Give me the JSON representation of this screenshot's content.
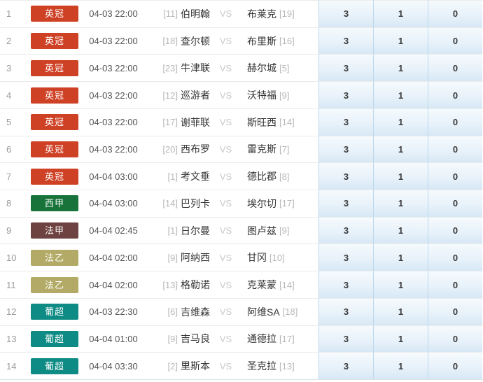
{
  "league_colors": {
    "英冠": "#ce4125",
    "西甲": "#177339",
    "法甲": "#6e4240",
    "法乙": "#b2aa66",
    "葡超": "#0e8b84"
  },
  "odds_colors": {
    "cell_bg_top": "#f5fafd",
    "cell_bg_bottom": "#d7e8f5",
    "cell_border": "#bdd7eb"
  },
  "table": {
    "rows": [
      {
        "num": "1",
        "league": "英冠",
        "time": "04-03 22:00",
        "home_rank": "[11]",
        "home": "伯明翰",
        "vs": "VS",
        "away": "布莱克",
        "away_rank": "[19]",
        "odds": [
          "3",
          "1",
          "0"
        ]
      },
      {
        "num": "2",
        "league": "英冠",
        "time": "04-03 22:00",
        "home_rank": "[18]",
        "home": "查尔顿",
        "vs": "VS",
        "away": "布里斯",
        "away_rank": "[16]",
        "odds": [
          "3",
          "1",
          "0"
        ]
      },
      {
        "num": "3",
        "league": "英冠",
        "time": "04-03 22:00",
        "home_rank": "[23]",
        "home": "牛津联",
        "vs": "VS",
        "away": "赫尔城",
        "away_rank": "[5]",
        "odds": [
          "3",
          "1",
          "0"
        ]
      },
      {
        "num": "4",
        "league": "英冠",
        "time": "04-03 22:00",
        "home_rank": "[12]",
        "home": "巡游者",
        "vs": "VS",
        "away": "沃特福",
        "away_rank": "[9]",
        "odds": [
          "3",
          "1",
          "0"
        ]
      },
      {
        "num": "5",
        "league": "英冠",
        "time": "04-03 22:00",
        "home_rank": "[17]",
        "home": "谢菲联",
        "vs": "VS",
        "away": "斯旺西",
        "away_rank": "[14]",
        "odds": [
          "3",
          "1",
          "0"
        ]
      },
      {
        "num": "6",
        "league": "英冠",
        "time": "04-03 22:00",
        "home_rank": "[20]",
        "home": "西布罗",
        "vs": "VS",
        "away": "雷克斯",
        "away_rank": "[7]",
        "odds": [
          "3",
          "1",
          "0"
        ]
      },
      {
        "num": "7",
        "league": "英冠",
        "time": "04-04 03:00",
        "home_rank": "[1]",
        "home": "考文垂",
        "vs": "VS",
        "away": "德比郡",
        "away_rank": "[8]",
        "odds": [
          "3",
          "1",
          "0"
        ]
      },
      {
        "num": "8",
        "league": "西甲",
        "time": "04-04 03:00",
        "home_rank": "[14]",
        "home": "巴列卡",
        "vs": "VS",
        "away": "埃尔切",
        "away_rank": "[17]",
        "odds": [
          "3",
          "1",
          "0"
        ]
      },
      {
        "num": "9",
        "league": "法甲",
        "time": "04-04 02:45",
        "home_rank": "[1]",
        "home": "日尔曼",
        "vs": "VS",
        "away": "图卢兹",
        "away_rank": "[9]",
        "odds": [
          "3",
          "1",
          "0"
        ]
      },
      {
        "num": "10",
        "league": "法乙",
        "time": "04-04 02:00",
        "home_rank": "[9]",
        "home": "阿纳西",
        "vs": "VS",
        "away": "甘冈",
        "away_rank": "[10]",
        "odds": [
          "3",
          "1",
          "0"
        ]
      },
      {
        "num": "11",
        "league": "法乙",
        "time": "04-04 02:00",
        "home_rank": "[13]",
        "home": "格勒诺",
        "vs": "VS",
        "away": "克莱蒙",
        "away_rank": "[14]",
        "odds": [
          "3",
          "1",
          "0"
        ]
      },
      {
        "num": "12",
        "league": "葡超",
        "time": "04-03 22:30",
        "home_rank": "[6]",
        "home": "吉维森",
        "vs": "VS",
        "away": "阿维SA",
        "away_rank": "[18]",
        "odds": [
          "3",
          "1",
          "0"
        ]
      },
      {
        "num": "13",
        "league": "葡超",
        "time": "04-04 01:00",
        "home_rank": "[9]",
        "home": "吉马良",
        "vs": "VS",
        "away": "通德拉",
        "away_rank": "[17]",
        "odds": [
          "3",
          "1",
          "0"
        ]
      },
      {
        "num": "14",
        "league": "葡超",
        "time": "04-04 03:30",
        "home_rank": "[2]",
        "home": "里斯本",
        "vs": "VS",
        "away": "圣克拉",
        "away_rank": "[13]",
        "odds": [
          "3",
          "1",
          "0"
        ]
      }
    ]
  }
}
